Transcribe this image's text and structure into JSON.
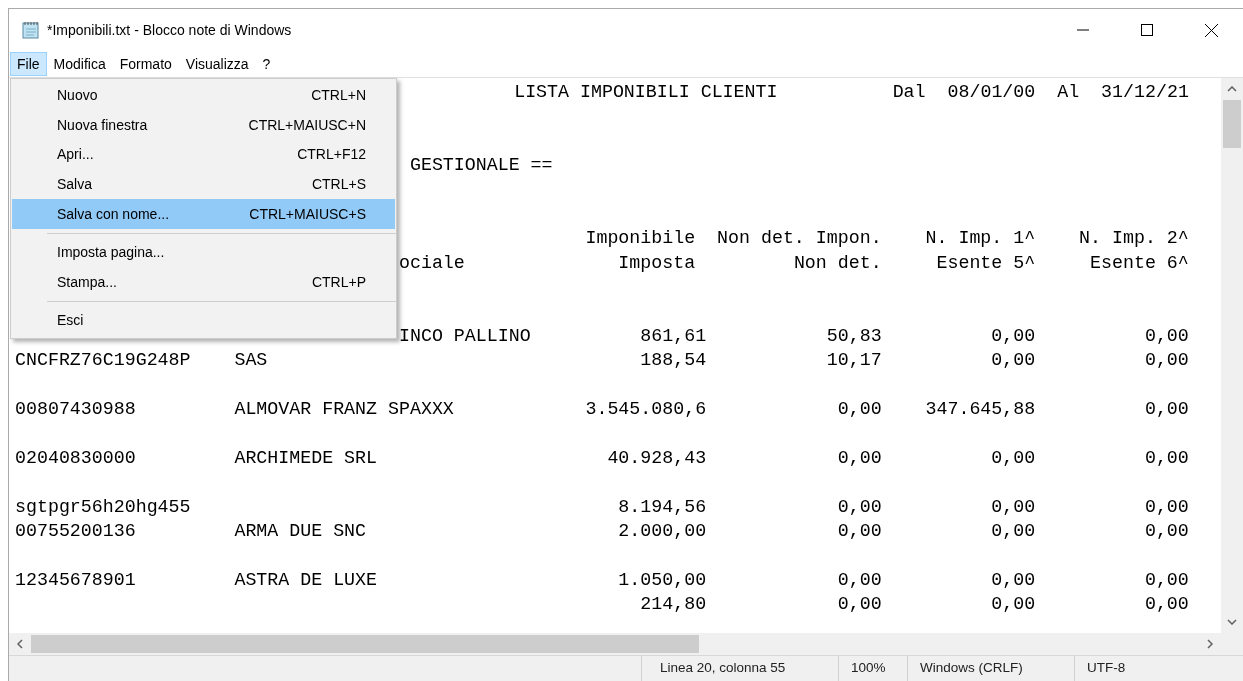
{
  "window": {
    "title": "*Imponibili.txt - Blocco note di Windows"
  },
  "menu_bar": [
    {
      "label": "File",
      "selected": true
    },
    {
      "label": "Modifica",
      "selected": false
    },
    {
      "label": "Formato",
      "selected": false
    },
    {
      "label": "Visualizza",
      "selected": false
    },
    {
      "label": "?",
      "selected": false
    }
  ],
  "file_menu": [
    {
      "kind": "item",
      "label": "Nuovo",
      "shortcut": "CTRL+N",
      "selected": false
    },
    {
      "kind": "item",
      "label": "Nuova finestra",
      "shortcut": "CTRL+MAIUSC+N",
      "selected": false
    },
    {
      "kind": "item",
      "label": "Apri...",
      "shortcut": "CTRL+F12",
      "selected": false
    },
    {
      "kind": "item",
      "label": "Salva",
      "shortcut": "CTRL+S",
      "selected": false
    },
    {
      "kind": "item",
      "label": "Salva con nome...",
      "shortcut": "CTRL+MAIUSC+S",
      "selected": true
    },
    {
      "kind": "separator"
    },
    {
      "kind": "item",
      "label": "Imposta pagina...",
      "selected": false
    },
    {
      "kind": "item",
      "label": "Stampa...",
      "shortcut": "CTRL+P",
      "selected": false
    },
    {
      "kind": "separator"
    },
    {
      "kind": "item",
      "label": "Esci",
      "selected": false
    }
  ],
  "document_lines": [
    {
      "kind": "title",
      "title": "LISTA IMPONIBILI CLIENTI",
      "from_label": "Dal",
      "from_date": "08/01/00",
      "to_label": "Al",
      "to_date": "31/12/21"
    },
    {
      "kind": "blank"
    },
    {
      "kind": "blank"
    },
    {
      "kind": "note",
      "text": "GESTIONALE =="
    },
    {
      "kind": "blank"
    },
    {
      "kind": "blank"
    },
    {
      "kind": "header",
      "imponibile": "Imponibile",
      "non_det": "Non det. Impon.",
      "n_imp_1": "N. Imp. 1^",
      "n_imp_2": "N. Imp. 2^"
    },
    {
      "kind": "header",
      "name_tail": "ociale",
      "imponibile": "Imposta",
      "non_det": "Non det.",
      "n_imp_1": "Esente 5^",
      "n_imp_2": "Esente 6^"
    },
    {
      "kind": "blank"
    },
    {
      "kind": "blank"
    },
    {
      "kind": "row",
      "name_tail": "INCO PALLINO",
      "imponibile": "861,61",
      "non_det": "50,83",
      "n_imp_1": "0,00",
      "n_imp_2": "0,00"
    },
    {
      "kind": "row",
      "code": "CNCFRZ76C19G248P",
      "name": "SAS",
      "imponibile": "188,54",
      "non_det": "10,17",
      "n_imp_1": "0,00",
      "n_imp_2": "0,00"
    },
    {
      "kind": "blank"
    },
    {
      "kind": "row",
      "code": "00807430988",
      "name": "ALMOVAR FRANZ SPAXXX",
      "imponibile": "3.545.080,6",
      "non_det": "0,00",
      "n_imp_1": "347.645,88",
      "n_imp_2": "0,00"
    },
    {
      "kind": "blank"
    },
    {
      "kind": "row",
      "code": "02040830000",
      "name": "ARCHIMEDE SRL",
      "imponibile": "40.928,43",
      "non_det": "0,00",
      "n_imp_1": "0,00",
      "n_imp_2": "0,00"
    },
    {
      "kind": "blank"
    },
    {
      "kind": "row",
      "code": "sgtpgr56h20hg455",
      "imponibile": "8.194,56",
      "non_det": "0,00",
      "n_imp_1": "0,00",
      "n_imp_2": "0,00"
    },
    {
      "kind": "row",
      "code": "00755200136",
      "name": "ARMA DUE SNC",
      "imponibile": "2.000,00",
      "non_det": "0,00",
      "n_imp_1": "0,00",
      "n_imp_2": "0,00"
    },
    {
      "kind": "blank"
    },
    {
      "kind": "row",
      "code": "12345678901",
      "name": "ASTRA DE LUXE",
      "imponibile": "1.050,00",
      "non_det": "0,00",
      "n_imp_1": "0,00",
      "n_imp_2": "0,00"
    },
    {
      "kind": "row",
      "imponibile": "214,80",
      "non_det": "0,00",
      "n_imp_1": "0,00",
      "n_imp_2": "0,00"
    }
  ],
  "status_bar": {
    "position": "Linea 20, colonna 55",
    "zoom": "100%",
    "line_endings": "Windows (CRLF)",
    "encoding": "UTF-8"
  }
}
